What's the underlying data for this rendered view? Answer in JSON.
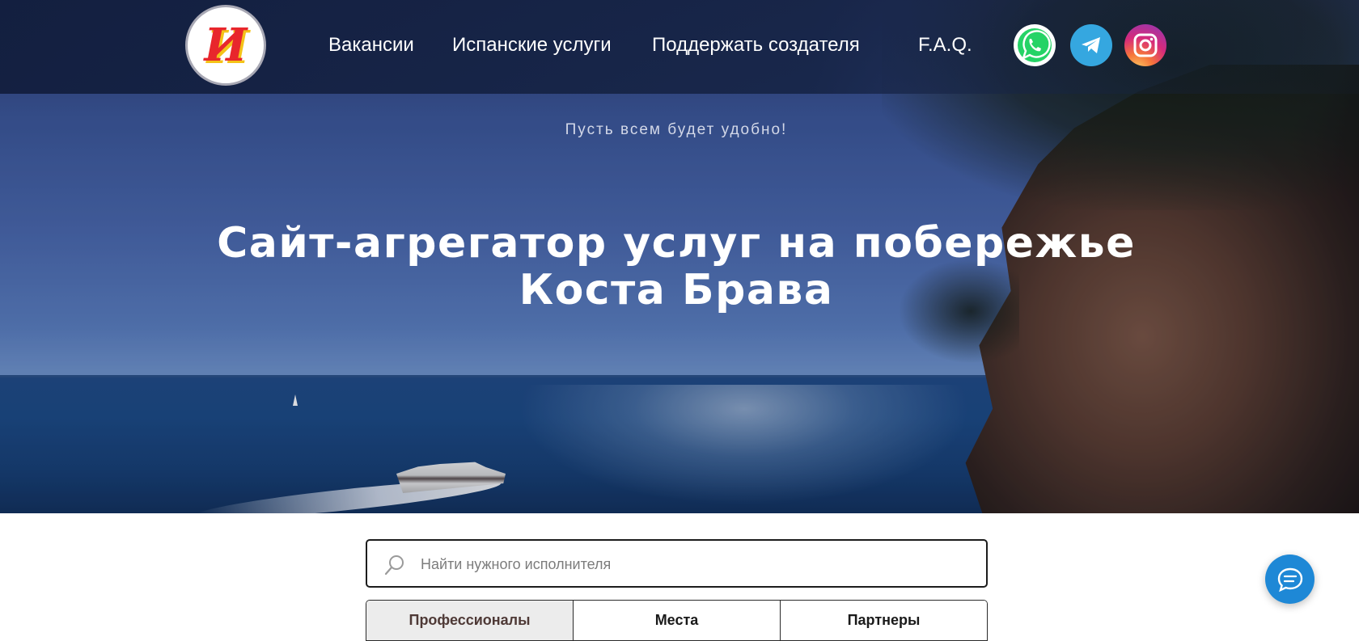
{
  "colors": {
    "header_bg": "#15223f",
    "chat_button": "#1e88d6",
    "telegram": "#35a7e0",
    "whatsapp": "#25d366",
    "logo_red": "#e8262c",
    "logo_yellow": "#f4c318"
  },
  "header": {
    "logo_text": "И",
    "nav": [
      {
        "label": "Вакансии"
      },
      {
        "label": "Испанские услуги"
      },
      {
        "label": "Поддержать создателя"
      },
      {
        "label": "F.A.Q."
      }
    ],
    "social": [
      {
        "icon": "whatsapp-icon"
      },
      {
        "icon": "telegram-icon"
      },
      {
        "icon": "instagram-icon"
      }
    ]
  },
  "hero": {
    "tagline": "Пусть всем будет удобно!",
    "title_line1": "Сайт-агрегатор услуг на побережье",
    "title_line2": "Коста Брава"
  },
  "search": {
    "placeholder": "Найти нужного исполнителя",
    "value": ""
  },
  "tabs": [
    {
      "label": "Профессионалы",
      "active": true
    },
    {
      "label": "Места",
      "active": false
    },
    {
      "label": "Партнеры",
      "active": false
    }
  ],
  "chat": {
    "icon": "chat-bubble-icon"
  }
}
